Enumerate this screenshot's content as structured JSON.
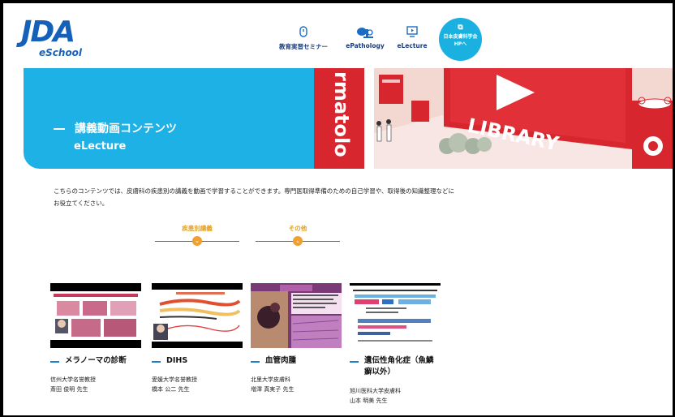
{
  "logo": {
    "main": "JDA",
    "sub": "eSchool"
  },
  "nav": {
    "seminar": "教育実習セミナー",
    "epathology": "ePathology",
    "electure": "eLecture",
    "jda_line1": "日本皮膚科学会",
    "jda_line2": "HPへ"
  },
  "hero": {
    "title": "講義動画コンテンツ",
    "subtitle": "eLecture",
    "art_word": "LIBRARY",
    "art_side_text": "rmatolo"
  },
  "intro": "こちらのコンテンツでは、皮膚科の疾患別の講義を動画で学習することができます。専門医取得準備のための自己学習や、取得後の知識整理などにお役立てください。",
  "tabs": [
    {
      "label": "疾患別講義"
    },
    {
      "label": "その他"
    }
  ],
  "cards": [
    {
      "title": "メラノーマの診断",
      "aff": "信州大学名誉教授",
      "name": "斎田 俊明 先生"
    },
    {
      "title": "DIHS",
      "aff": "愛媛大学名誉教授",
      "name": "橋本 公二 先生"
    },
    {
      "title": "血管肉腫",
      "aff": "北里大学皮膚科",
      "name": "増澤 真実子 先生"
    },
    {
      "title": "遺伝性角化症（魚鱗癬以外）",
      "aff": "旭川医科大学皮膚科",
      "name": "山本 明美 先生"
    }
  ],
  "colors": {
    "brand_blue": "#1560b8",
    "hero_blue": "#1eb1e6",
    "accent_orange": "#f0a030",
    "red": "#d8262e"
  }
}
